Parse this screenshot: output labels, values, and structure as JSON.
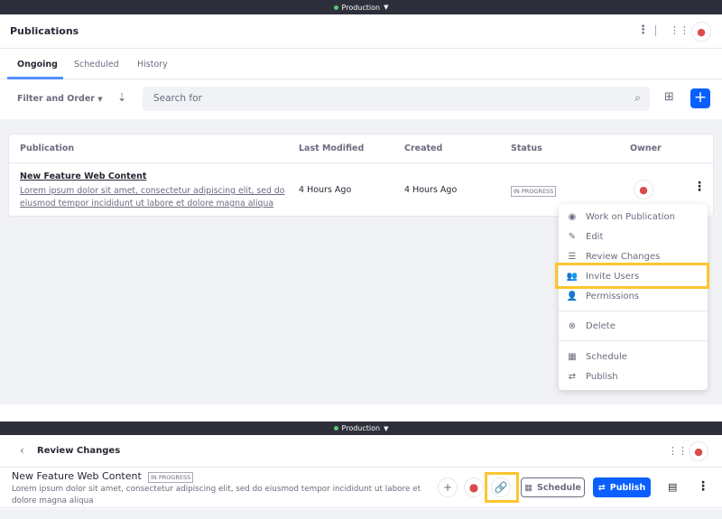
{
  "env": {
    "name": "Production"
  },
  "header": {
    "title": "Publications"
  },
  "tabs": [
    {
      "label": "Ongoing",
      "active": true
    },
    {
      "label": "Scheduled"
    },
    {
      "label": "History"
    }
  ],
  "toolbar": {
    "filter_label": "Filter and Order",
    "search_placeholder": "Search for"
  },
  "table": {
    "headers": [
      "Publication",
      "Last Modified",
      "Created",
      "Status",
      "Owner"
    ],
    "rows": [
      {
        "title": "New Feature Web Content",
        "description": "Lorem ipsum dolor sit amet, consectetur adipiscing elit, sed do eiusmod tempor incididunt ut labore et dolore magna aliqua",
        "last_modified": "4 Hours Ago",
        "created": "4 Hours Ago",
        "status": "IN PROGRESS"
      }
    ]
  },
  "menu": {
    "items": [
      {
        "label": "Work on Publication",
        "icon": "radio-icon"
      },
      {
        "label": "Edit",
        "icon": "pencil-icon"
      },
      {
        "label": "Review Changes",
        "icon": "list-icon"
      },
      {
        "label": "Invite Users",
        "icon": "users-icon",
        "highlighted": true
      },
      {
        "label": "Permissions",
        "icon": "user-lock-icon"
      },
      {
        "label": "Delete",
        "icon": "times-circle-icon"
      },
      {
        "label": "Schedule",
        "icon": "calendar-icon"
      },
      {
        "label": "Publish",
        "icon": "sync-icon"
      }
    ]
  },
  "review": {
    "back_title": "Review Changes",
    "title": "New Feature Web Content",
    "status": "IN PROGRESS",
    "description": "Lorem ipsum dolor sit amet, consectetur adipiscing elit, sed do eiusmod tempor incididunt ut labore et dolore magna aliqua",
    "schedule_label": "Schedule",
    "publish_label": "Publish"
  },
  "colors": {
    "primary": "#0b5fff",
    "highlight": "#fdc52f",
    "topbar": "#2d2f3b"
  }
}
